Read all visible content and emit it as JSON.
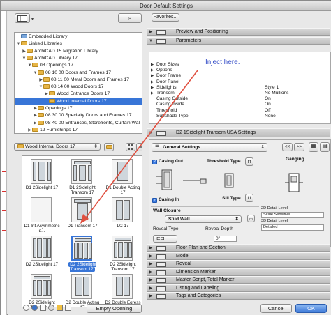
{
  "window": {
    "title": "Door Default Settings"
  },
  "left": {
    "tree": [
      {
        "label": "Embedded Library",
        "indent": 0,
        "tri": "",
        "icon": "folder-blue"
      },
      {
        "label": "Linked Libraries",
        "indent": 0,
        "tri": "▼",
        "icon": "folder"
      },
      {
        "label": "ArchiCAD 15 Migration Library",
        "indent": 1,
        "tri": "▶",
        "icon": "folder"
      },
      {
        "label": "ArchiCAD Library 17",
        "indent": 1,
        "tri": "▼",
        "icon": "folder"
      },
      {
        "label": "08 Openings 17",
        "indent": 2,
        "tri": "▼",
        "icon": "folder"
      },
      {
        "label": "08 10 00 Doors and Frames 17",
        "indent": 3,
        "tri": "▼",
        "icon": "folder"
      },
      {
        "label": "08 11 00 Metal Doors and Frames 17",
        "indent": 4,
        "tri": "▶",
        "icon": "folder"
      },
      {
        "label": "08 14 00 Wood Doors 17",
        "indent": 4,
        "tri": "▼",
        "icon": "folder"
      },
      {
        "label": "Wood Entrance Doors 17",
        "indent": 5,
        "tri": "▶",
        "icon": "folder"
      },
      {
        "label": "Wood Internal Doors 17",
        "indent": 5,
        "tri": "",
        "icon": "folder",
        "selected": true
      },
      {
        "label": "Openings 17",
        "indent": 3,
        "tri": "▶",
        "icon": "folder"
      },
      {
        "label": "08 30 00 Specialty Doors and Frames 17",
        "indent": 3,
        "tri": "▶",
        "icon": "folder"
      },
      {
        "label": "08 40 00 Entrances, Storefronts, Curtain Wal",
        "indent": 3,
        "tri": "▶",
        "icon": "folder"
      },
      {
        "label": "12 Furnishings 17",
        "indent": 2,
        "tri": "▶",
        "icon": "folder"
      }
    ],
    "folder_select": "Wood Internal Doors 17",
    "items": [
      {
        "label": "D1 2Sidelight 17",
        "kind": "single-side"
      },
      {
        "label": "D1 2Sidelight Transom 17",
        "kind": "single-side-transom"
      },
      {
        "label": "D1 Double Acting 17",
        "kind": "single"
      },
      {
        "label": "D1 Int Asymmetric d...",
        "kind": "blank"
      },
      {
        "label": "D1 Transom 17",
        "kind": "single-transom"
      },
      {
        "label": "D2 17",
        "kind": "double"
      },
      {
        "label": "D2 2Sidelight 17",
        "kind": "double-side"
      },
      {
        "label": "D2 2Sidelight Transom 17",
        "kind": "double-side-transom",
        "selected": true
      },
      {
        "label": "D2 2Sidelight Transom 17",
        "kind": "double-side-transom"
      },
      {
        "label": "D2 2Sidelight Transom 17",
        "kind": "double-side-transom"
      },
      {
        "label": "D2 Double Acting 17",
        "kind": "double"
      },
      {
        "label": "D2 Double Egress 17",
        "kind": "double"
      }
    ],
    "empty_opening_label": "Empty Opening"
  },
  "right": {
    "favorites_label": "Favorites...",
    "sections_top": [
      {
        "title": "Preview and Positioning",
        "expanded": false
      },
      {
        "title": "Parameters",
        "expanded": true
      }
    ],
    "params": [
      {
        "label": "Door Sizes",
        "value": "",
        "tri": true
      },
      {
        "label": "Options",
        "value": "",
        "tri": true
      },
      {
        "label": "Door Frame",
        "value": "",
        "tri": true
      },
      {
        "label": "Door Panel",
        "value": "",
        "tri": true
      },
      {
        "label": "Sidelights",
        "value": "Style 1",
        "tri": true
      },
      {
        "label": "Transom",
        "value": "No Mullions",
        "tri": true
      },
      {
        "label": "Casing Outside",
        "value": "On",
        "tri": false
      },
      {
        "label": "Casing Inside",
        "value": "On",
        "tri": false
      },
      {
        "label": "Threshold",
        "value": "Off",
        "tri": false
      },
      {
        "label": "Subshade Type",
        "value": "None",
        "tri": false
      }
    ],
    "annotation": "Inject here.",
    "object_settings_title": "D2 1Sidelight Transom USA Settings",
    "general_settings": "General Settings",
    "prev_label": "<<",
    "next_label": ">>",
    "casing_out_label": "Casing Out",
    "threshold_type_label": "Threshold Type",
    "ganging_label": "Ganging",
    "casing_in_label": "Casing In",
    "sill_type_label": "Sill Type",
    "wall_closure_label": "Wall Closure",
    "wall_closure_value": "Stud Wall",
    "reveal_type_label": "Reveal Type",
    "reveal_depth_label": "Reveal Depth",
    "reveal_depth_value": "0\"",
    "detail_2d_label": "2D Detail Level",
    "detail_2d_value": "Scale Sensitive",
    "detail_3d_label": "3D Detail Level",
    "detail_3d_value": "Detailed",
    "sections_bottom": [
      "Floor Plan and Section",
      "Model",
      "Reveal",
      "Dimension Marker",
      "Master Script, Total Marker",
      "Listing and Labeling",
      "Tags and Categories"
    ],
    "cancel_label": "Cancel",
    "ok_label": "OK"
  },
  "colors": {
    "selection": "#3875d7",
    "annotation_arrow": "#e05040",
    "annotation_text": "#3a52c8"
  }
}
